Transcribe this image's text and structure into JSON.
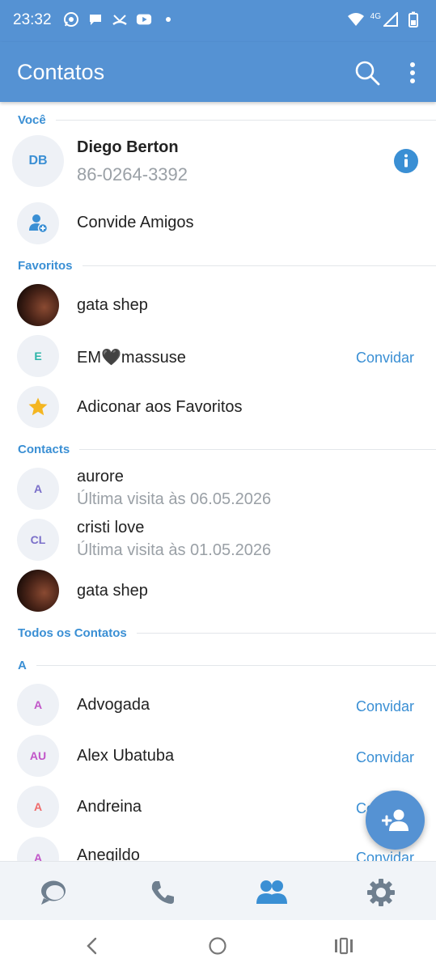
{
  "status": {
    "time": "23:32",
    "network": "4G"
  },
  "appbar": {
    "title": "Contatos"
  },
  "sections": {
    "you": "Você",
    "favorites": "Favoritos",
    "contacts": "Contacts",
    "all": "Todos os Contatos",
    "letter_a": "A"
  },
  "me": {
    "initials": "DB",
    "name": "Diego Berton",
    "phone": "86-0264-3392"
  },
  "invite_friends": "Convide Amigos",
  "favorites": [
    {
      "name": "gata shep"
    },
    {
      "initials": "E",
      "name": "EM🖤massuse",
      "action": "Convidar",
      "color": "#2bb5a8"
    }
  ],
  "add_favorites": "Adiconar aos Favoritos",
  "contacts": [
    {
      "initials": "A",
      "name": "aurore",
      "sub": "Última visita às 06.05.2026",
      "color": "#7a6fc9"
    },
    {
      "initials": "CL",
      "name": "cristi love",
      "sub": "Última visita às 01.05.2026",
      "color": "#7a6fc9"
    },
    {
      "name": "gata shep"
    }
  ],
  "all_contacts": [
    {
      "initials": "A",
      "name": "Advogada",
      "action": "Convidar",
      "color": "#c155c8"
    },
    {
      "initials": "AU",
      "name": "Alex Ubatuba",
      "action": "Convidar",
      "color": "#c155c8"
    },
    {
      "initials": "A",
      "name": "Andreina",
      "action": "Convidar",
      "color": "#ef6b6b"
    },
    {
      "initials": "A",
      "name": "Anegildo",
      "action": "Convidar",
      "color": "#c155c8"
    }
  ],
  "colors": {
    "primary": "#5592d3",
    "accent": "#3a8fd4",
    "star": "#f4b621",
    "muted": "#9aa0a6"
  },
  "icons": {
    "status": [
      "whatsapp-icon",
      "chat-bubble-icon",
      "missed-call-icon",
      "youtube-icon",
      "dot-icon",
      "wifi-icon",
      "signal-icon",
      "battery-icon"
    ],
    "appbar": [
      "search-icon",
      "more-vert-icon"
    ],
    "nav": [
      "chats-icon",
      "calls-icon",
      "contacts-icon",
      "settings-icon"
    ],
    "fab": "add-contact-icon",
    "system": [
      "back-icon",
      "home-icon",
      "recents-icon"
    ]
  }
}
